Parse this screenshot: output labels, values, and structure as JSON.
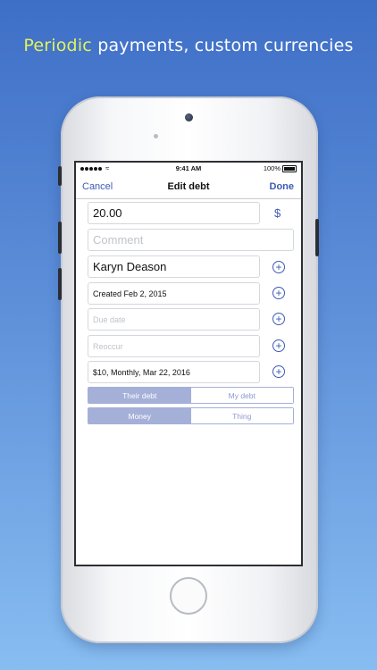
{
  "promo": {
    "headline_highlight": "Periodic",
    "headline_rest": " payments, custom currencies"
  },
  "status_bar": {
    "time": "9:41 AM",
    "battery": "100%"
  },
  "nav": {
    "cancel": "Cancel",
    "title": "Edit debt",
    "done": "Done"
  },
  "form": {
    "amount": "20.00",
    "currency_symbol": "$",
    "comment_placeholder": "Comment",
    "name": "Karyn Deason",
    "created": "Created Feb 2, 2015",
    "due_placeholder": "Due date",
    "reoccur_placeholder": "Reoccur",
    "recurrence": "$10, Monthly, Mar 22, 2016",
    "plus_glyph": "+"
  },
  "segments": {
    "direction": {
      "options": [
        "Their debt",
        "My debt"
      ],
      "selected": "Their debt"
    },
    "kind": {
      "options": [
        "Money",
        "Thing"
      ],
      "selected": "Money"
    }
  },
  "colors": {
    "accent": "#3d5ab5",
    "segment_selected": "#a4b0d8",
    "headline_highlight": "#e4f25a"
  }
}
